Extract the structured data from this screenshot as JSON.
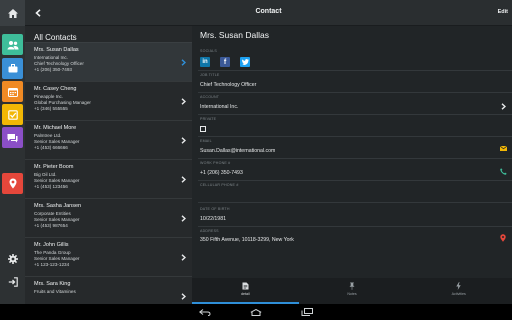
{
  "topbar": {
    "title": "Contact",
    "edit_label": "Edit"
  },
  "rail": {
    "home_icon": "home-icon",
    "items": [
      {
        "name": "contacts",
        "icon": "people-icon",
        "color": "#3ebd9a"
      },
      {
        "name": "accounts",
        "icon": "briefcase-icon",
        "color": "#3a8fd6"
      },
      {
        "name": "calendar",
        "icon": "calendar-icon",
        "color": "#f08a24"
      },
      {
        "name": "tasks",
        "icon": "checkbox-icon",
        "color": "#f2b705"
      },
      {
        "name": "chat",
        "icon": "chat-icon",
        "color": "#8b4fc7"
      },
      {
        "name": "map",
        "icon": "location-pin-icon",
        "color": "#e5473b"
      }
    ],
    "bottom": [
      {
        "name": "settings",
        "icon": "gear-icon"
      },
      {
        "name": "logout",
        "icon": "logout-icon"
      }
    ]
  },
  "list": {
    "header": "All Contacts",
    "contacts": [
      {
        "name": "Mrs. Susan Dallas",
        "company": "International Inc.",
        "title": "Chief Technology Officer",
        "phone": "+1 (206) 350-7493"
      },
      {
        "name": "Mr. Casey Cheng",
        "company": "Pineapple Inc.",
        "title": "Global Purchasing Manager",
        "phone": "+1 (346) 555555"
      },
      {
        "name": "Mr. Michael More",
        "company": "Palmtree Ltd.",
        "title": "Senior Sales Manager",
        "phone": "+1 (453) 666666"
      },
      {
        "name": "Mr. Pieter Boom",
        "company": "Big Oil Ltd.",
        "title": "Senior Sales Manager",
        "phone": "+1 (453) 123456"
      },
      {
        "name": "Mrs. Sasha Jansen",
        "company": "Corporate Entities",
        "title": "Senior Sales Manager",
        "phone": "+1 (453) 987654"
      },
      {
        "name": "Mr. John Gillis",
        "company": "The Panda Group",
        "title": "Senior Sales Manager",
        "phone": "+1 123-123-1234"
      },
      {
        "name": "Mrs. Sara King",
        "company": "Fruits and Vitamines",
        "title": "",
        "phone": ""
      }
    ]
  },
  "detail": {
    "name": "Mrs. Susan Dallas",
    "socials_label": "SOCIALS",
    "socials": [
      "in",
      "f",
      "t"
    ],
    "job_title_label": "JOB TITLE",
    "job_title": "Chief Technology Officer",
    "account_label": "ACCOUNT",
    "account": "International Inc.",
    "private_label": "PRIVATE",
    "email_label": "EMAIL",
    "email": "Susan.Dallas@international.com",
    "work_phone_label": "WORK PHONE #",
    "work_phone": "+1 (206) 350-7493",
    "cell_phone_label": "CELLULAR PHONE #",
    "dob_label": "DATE OF BIRTH",
    "dob": "10/22/1981",
    "address_label": "ADDRESS",
    "address": "350 Fifth Avenue, 10118-3299, New York"
  },
  "tabs": [
    {
      "label": "detail",
      "icon": "document-icon",
      "active": true
    },
    {
      "label": "Notes",
      "icon": "pin-icon",
      "active": false
    },
    {
      "label": "Activities",
      "icon": "lightning-icon",
      "active": false
    }
  ],
  "colors": {
    "accent": "#2f8fd8",
    "linkedin": "#0e76a8",
    "facebook": "#3b5998",
    "twitter": "#1da1f2",
    "email_icon": "#f2b705",
    "phone_icon": "#3ebd9a",
    "address_icon": "#e5473b"
  }
}
